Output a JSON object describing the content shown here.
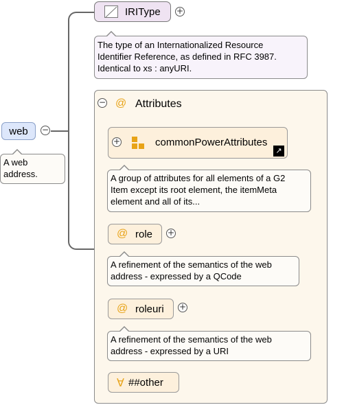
{
  "web": {
    "label": "web",
    "description": "A web address."
  },
  "iri_type": {
    "label": "IRIType",
    "description_lines": [
      "The type of an Internationalized Resource",
      "Identifier Reference, as defined in RFC 3987.",
      "Identical to xs : anyURI."
    ]
  },
  "attributes": {
    "label": "Attributes",
    "common": {
      "label": "commonPowerAttributes",
      "description_lines": [
        "A group of attributes for all elements of a G2",
        "Item except its root element, the itemMeta",
        "element and all of its..."
      ]
    },
    "role": {
      "label": "role",
      "description_lines": [
        "A refinement of the semantics of the web",
        "address - expressed by a QCode"
      ]
    },
    "roleuri": {
      "label": "roleuri",
      "description_lines": [
        "A refinement of the semantics of the web",
        "address - expressed by a URI"
      ]
    },
    "other": {
      "symbol": "∀",
      "label": "##other"
    }
  },
  "symbols": {
    "at": "@",
    "plus": "+",
    "minus": "−"
  }
}
